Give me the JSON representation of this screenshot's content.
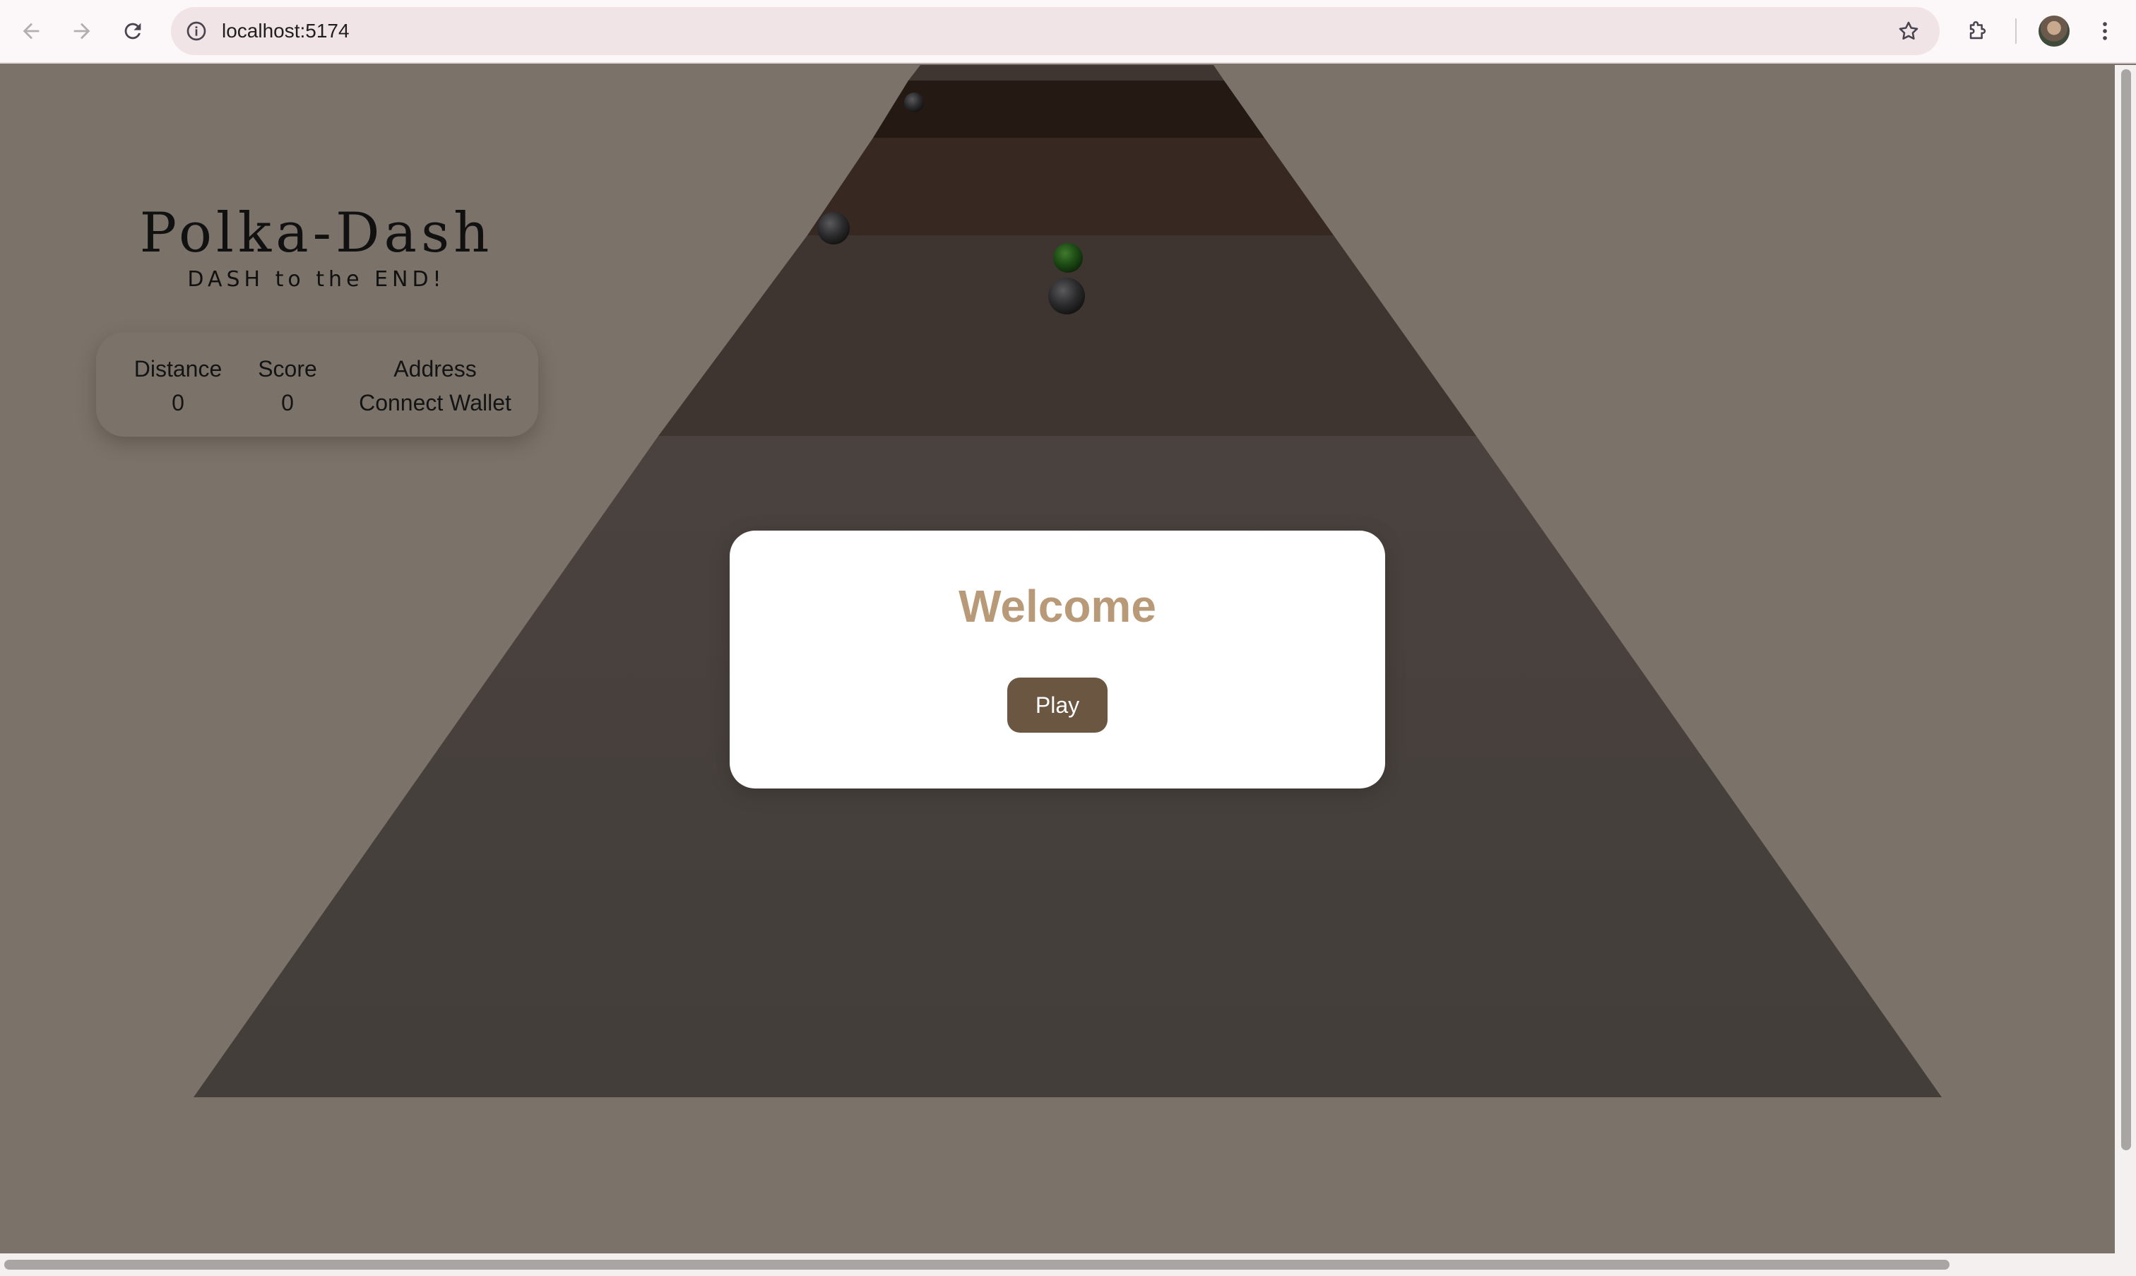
{
  "browser": {
    "url": "localhost:5174",
    "icons": {
      "back": "arrow-left-icon",
      "forward": "arrow-right-icon",
      "reload": "reload-icon",
      "site_info": "info-icon",
      "bookmark": "star-icon",
      "extensions": "puzzle-icon",
      "menu": "kebab-menu-icon"
    }
  },
  "game": {
    "title": "Polka-Dash",
    "subtitle": "DASH to the END!",
    "stats": {
      "distance_label": "Distance",
      "distance_value": "0",
      "score_label": "Score",
      "score_value": "0",
      "address_label": "Address",
      "address_value": "Connect Wallet"
    },
    "modal": {
      "title": "Welcome",
      "play_label": "Play"
    },
    "colors": {
      "background": "#7b736a",
      "track": "#453f3a",
      "accent_title": "#b99a78",
      "play_button": "#6b5641"
    }
  }
}
